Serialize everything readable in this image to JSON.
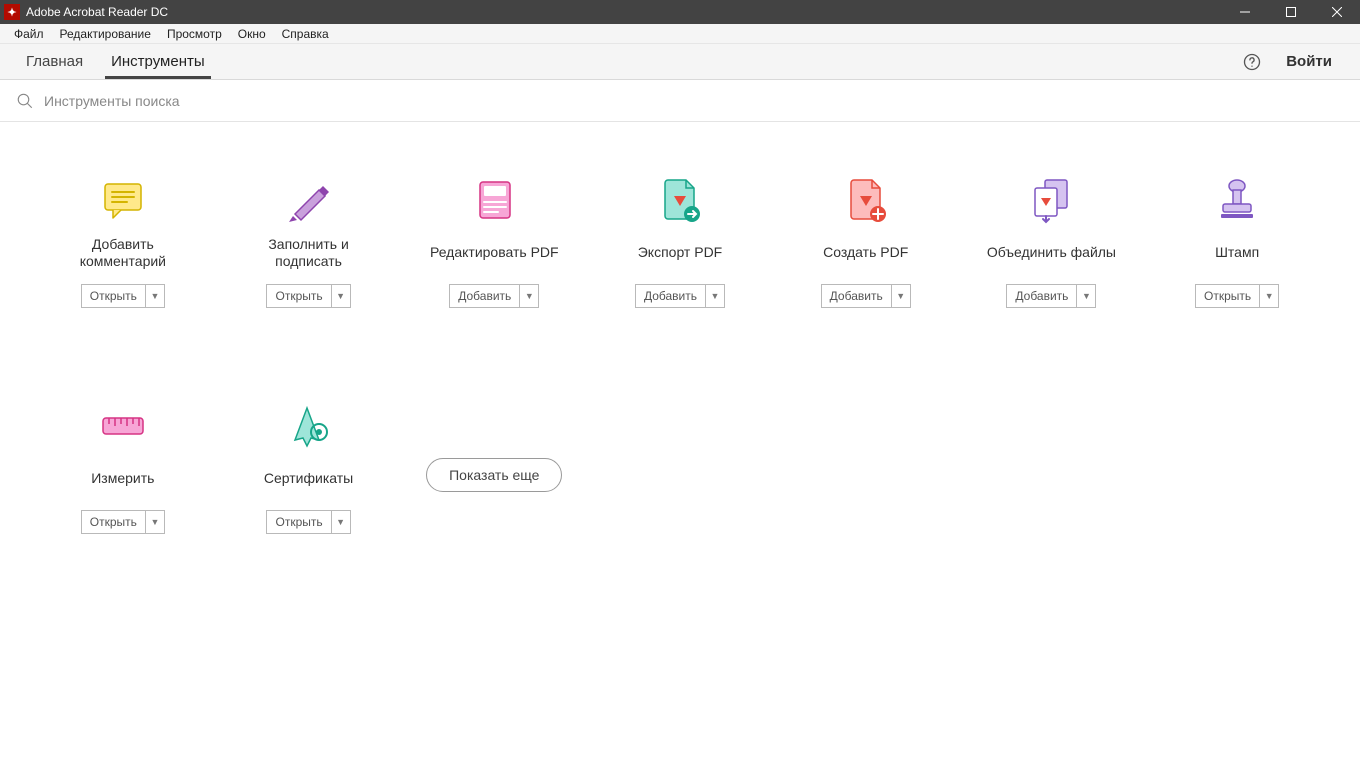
{
  "window": {
    "title": "Adobe Acrobat Reader DC"
  },
  "menu": {
    "file": "Файл",
    "edit": "Редактирование",
    "view": "Просмотр",
    "window": "Окно",
    "help": "Справка"
  },
  "tabs": {
    "home": "Главная",
    "tools": "Инструменты",
    "signin": "Войти"
  },
  "search": {
    "placeholder": "Инструменты поиска"
  },
  "actions": {
    "open": "Открыть",
    "add": "Добавить",
    "show_more": "Показать еще"
  },
  "tools": [
    {
      "id": "comment",
      "label": "Добавить\nкомментарий",
      "action": "open"
    },
    {
      "id": "fill-sign",
      "label": "Заполнить и\nподписать",
      "action": "open"
    },
    {
      "id": "edit-pdf",
      "label": "Редактировать PDF",
      "action": "add"
    },
    {
      "id": "export-pdf",
      "label": "Экспорт PDF",
      "action": "add"
    },
    {
      "id": "create-pdf",
      "label": "Создать PDF",
      "action": "add"
    },
    {
      "id": "combine",
      "label": "Объединить файлы",
      "action": "add"
    },
    {
      "id": "stamp",
      "label": "Штамп",
      "action": "open"
    },
    {
      "id": "measure",
      "label": "Измерить",
      "action": "open"
    },
    {
      "id": "certs",
      "label": "Сертификаты",
      "action": "open"
    }
  ]
}
